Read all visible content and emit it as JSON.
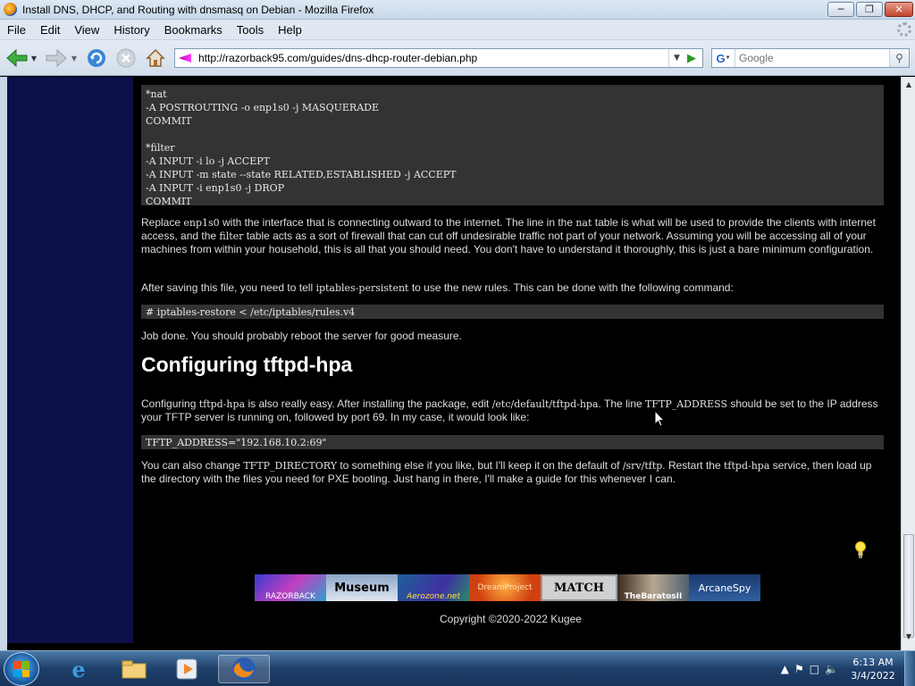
{
  "window": {
    "title": "Install DNS, DHCP, and Routing with dnsmasq on Debian - Mozilla Firefox",
    "minimize_icon": "minimize-icon",
    "maximize_icon": "maximize-icon",
    "close_icon": "close-icon"
  },
  "menubar": {
    "items": [
      "File",
      "Edit",
      "View",
      "History",
      "Bookmarks",
      "Tools",
      "Help"
    ]
  },
  "toolbar": {
    "url": "http://razorback95.com/guides/dns-dhcp-router-debian.php",
    "search_placeholder": "Google",
    "search_engine_letter": "G"
  },
  "page": {
    "code_block": "*nat\n-A POSTROUTING -o enp1s0 -j MASQUERADE\nCOMMIT\n\n*filter\n-A INPUT -i lo -j ACCEPT\n-A INPUT -m state --state RELATED,ESTABLISHED -j ACCEPT\n-A INPUT -i enp1s0 -j DROP\nCOMMIT",
    "para1": {
      "a": "Replace ",
      "code1": "enp1s0",
      "b": " with the interface that is connecting outward to the internet. The line in the ",
      "code2": "nat",
      "c": " table is what will be used to provide the clients with internet access, and the ",
      "code3": "filter",
      "d": " table acts as a sort of firewall that can cut off undesirable traffic not part of your network. Assuming you will be accessing all of your machines from within your household, this is all that you should need. You don't have to understand it thoroughly, this is just a bare minimum configuration."
    },
    "para2": {
      "a": "After saving this file, you need to tell ",
      "code1": "iptables-persistent",
      "b": " to use the new rules. This can be done with the following command:"
    },
    "command1": "# iptables-restore < /etc/iptables/rules.v4",
    "para3": "Job done. You should probably reboot the server for good measure.",
    "heading": "Configuring tftpd-hpa",
    "para4": {
      "a": "Configuring ",
      "code1": "tftpd-hpa",
      "b": " is also really easy. After installing the package, edit ",
      "code2": "/etc/default/tftpd-hpa",
      "c": ". The line ",
      "code3": "TFTP_ADDRESS",
      "d": " should be set to the IP address your TFTP server is running on, followed by port 69. In my case, it would look like:"
    },
    "command2": "TFTP_ADDRESS=\"192.168.10.2:69\"",
    "para5": {
      "a": "You can also change ",
      "code1": "TFTP_DIRECTORY",
      "b": " to something else if you like, but I'll keep it on the default of ",
      "code2": "/srv/tftp",
      "c": ". Restart the ",
      "code3": "tftpd-hpa",
      "d": " service, then load up the directory with the files you need for PXE booting. Just hang in there, I'll make a guide for this whenever I can."
    },
    "banners": [
      "RAZORBACK",
      "Museum",
      "Aerozone.net",
      "DreamProject",
      "MATCH",
      "TheBaratosII",
      "ArcaneSpy"
    ],
    "copyright": "Copyright ©2020-2022 Kugee"
  },
  "taskbar": {
    "time": "6:13 AM",
    "date": "3/4/2022",
    "ie_glyph": "e"
  },
  "colors": {
    "page_bg": "#000000",
    "sidebar_bg": "#0c0f4a",
    "code_bg": "#333333",
    "text": "#dddddd"
  }
}
